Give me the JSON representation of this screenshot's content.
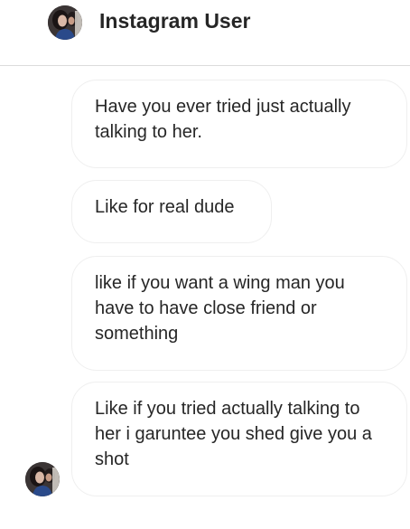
{
  "header": {
    "username": "Instagram User",
    "avatar_icon": "profile-photo"
  },
  "messages": [
    {
      "text": "Have you ever tried just actually talking to her."
    },
    {
      "text": "Like for real dude"
    },
    {
      "text": "like if you want a wing man you have to have close friend or something"
    },
    {
      "text": "Like if you tried actually talking to her i garuntee you shed give you a shot"
    }
  ],
  "colors": {
    "divider": "#dbdbdb",
    "bubble_border": "#efefef",
    "text": "#262626"
  }
}
